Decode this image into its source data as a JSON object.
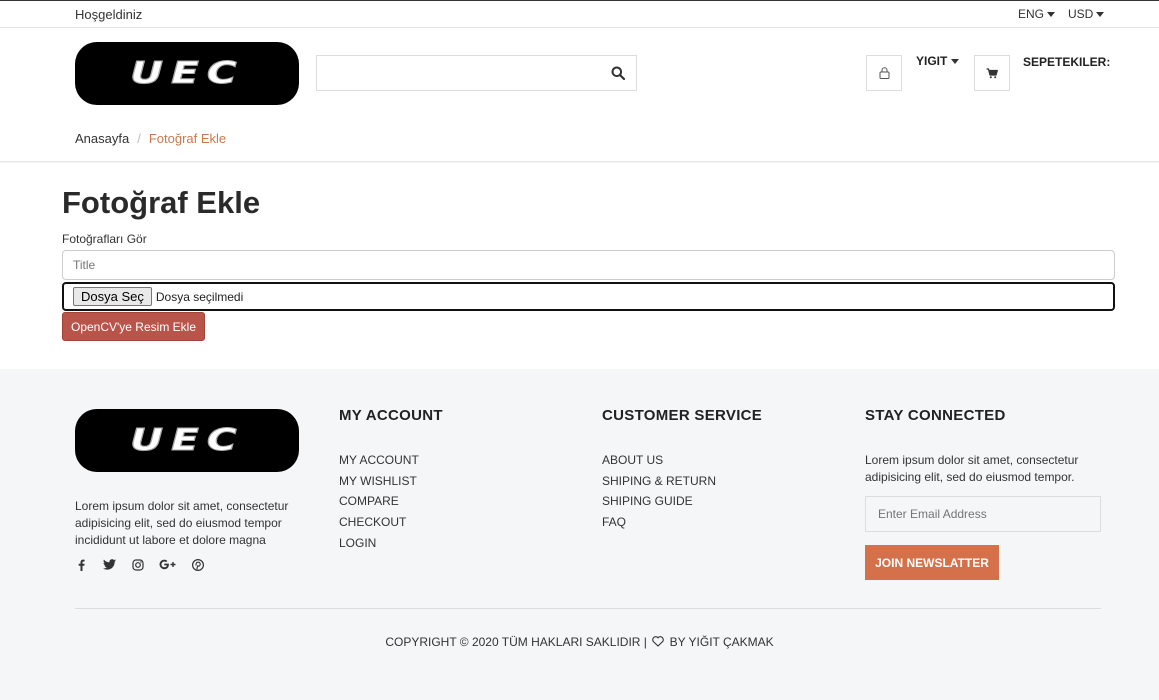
{
  "topbar": {
    "welcome": "Hoşgeldiniz",
    "language": "ENG",
    "currency": "USD"
  },
  "header": {
    "logo_text": "UEC",
    "search": {
      "placeholder": "",
      "value": ""
    },
    "user_label": "YIGIT",
    "cart_label": "SEPETEKILER:"
  },
  "breadcrumb": {
    "home": "Anasayfa",
    "separator": "/",
    "current": "Fotoğraf Ekle"
  },
  "main": {
    "title": "Fotoğraf Ekle",
    "label": "Fotoğrafları Gör",
    "title_placeholder": "Title",
    "file_button": "Dosya Seç",
    "file_status": "Dosya seçilmedi",
    "submit_label": "OpenCV'ye Resim Ekle"
  },
  "footer": {
    "logo_text": "UEC",
    "description": "Lorem ipsum dolor sit amet, consectetur adipisicing elit, sed do eiusmod tempor incididunt ut labore et dolore magna",
    "socials": [
      "facebook-icon",
      "twitter-icon",
      "instagram-icon",
      "google-plus-icon",
      "pinterest-icon"
    ],
    "my_account": {
      "title": "MY ACCOUNT",
      "links": [
        "MY ACCOUNT",
        "MY WISHLIST",
        "COMPARE",
        "CHECKOUT",
        "LOGIN"
      ]
    },
    "customer_service": {
      "title": "CUSTOMER SERVICE",
      "links": [
        "ABOUT US",
        "SHIPING & RETURN",
        "SHIPING GUIDE",
        "FAQ"
      ]
    },
    "stay_connected": {
      "title": "STAY CONNECTED",
      "description": "Lorem ipsum dolor sit amet, consectetur adipisicing elit, sed do eiusmod tempor.",
      "email_placeholder": "Enter Email Address",
      "button_label": "JOIN NEWSLATTER"
    },
    "copyright_left": "COPYRIGHT © 2020 TÜM HAKLARI SAKLIDIR |",
    "copyright_right": "BY YIĞIT ÇAKMAK"
  },
  "colors": {
    "accent": "#c8794e",
    "submit": "#b8544a",
    "join": "#d4714a"
  }
}
